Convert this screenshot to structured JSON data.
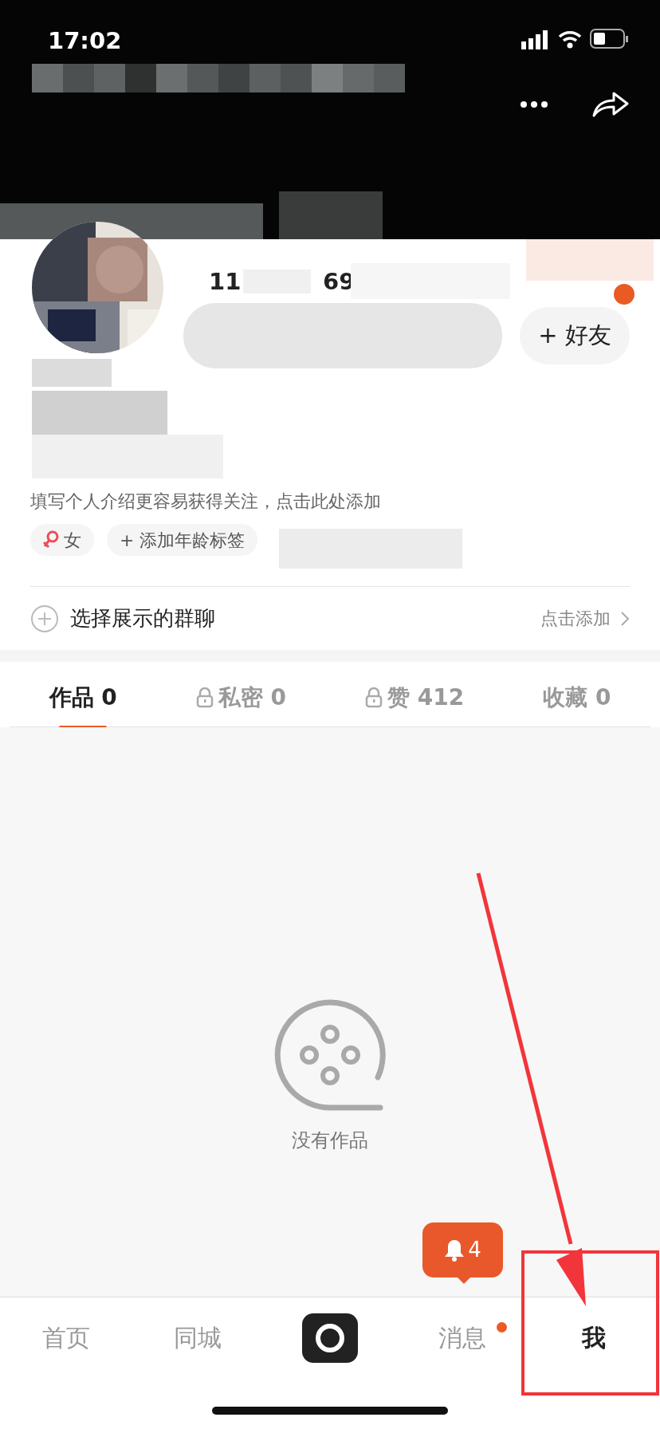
{
  "status_bar": {
    "time": "17:02"
  },
  "profile": {
    "stats": [
      {
        "value": "11"
      },
      {
        "value": "69"
      }
    ],
    "add_friend_button": "+ 好友",
    "bio": "填写个人介绍更容易获得关注，点击此处添加",
    "tags": [
      {
        "kind": "gender",
        "label": "女"
      },
      {
        "kind": "add",
        "label": "+ 添加年龄标签"
      }
    ]
  },
  "group_row": {
    "label": "选择展示的群聊",
    "action": "点击添加"
  },
  "tabs": [
    {
      "label": "作品",
      "count": "0",
      "locked": false,
      "selected": true
    },
    {
      "label": "私密",
      "count": "0",
      "locked": true,
      "selected": false
    },
    {
      "label": "赞",
      "count": "412",
      "locked": true,
      "selected": false
    },
    {
      "label": "收藏",
      "count": "0",
      "locked": false,
      "selected": false
    }
  ],
  "empty_state": {
    "text": "没有作品"
  },
  "notification_bubble": {
    "count": "4"
  },
  "bottom_nav": [
    {
      "kind": "text",
      "label": "首页",
      "selected": false,
      "dot": false
    },
    {
      "kind": "text",
      "label": "同城",
      "selected": false,
      "dot": false
    },
    {
      "kind": "camera"
    },
    {
      "kind": "text",
      "label": "消息",
      "selected": false,
      "dot": true
    },
    {
      "kind": "text",
      "label": "我",
      "selected": true,
      "dot": false
    }
  ]
}
